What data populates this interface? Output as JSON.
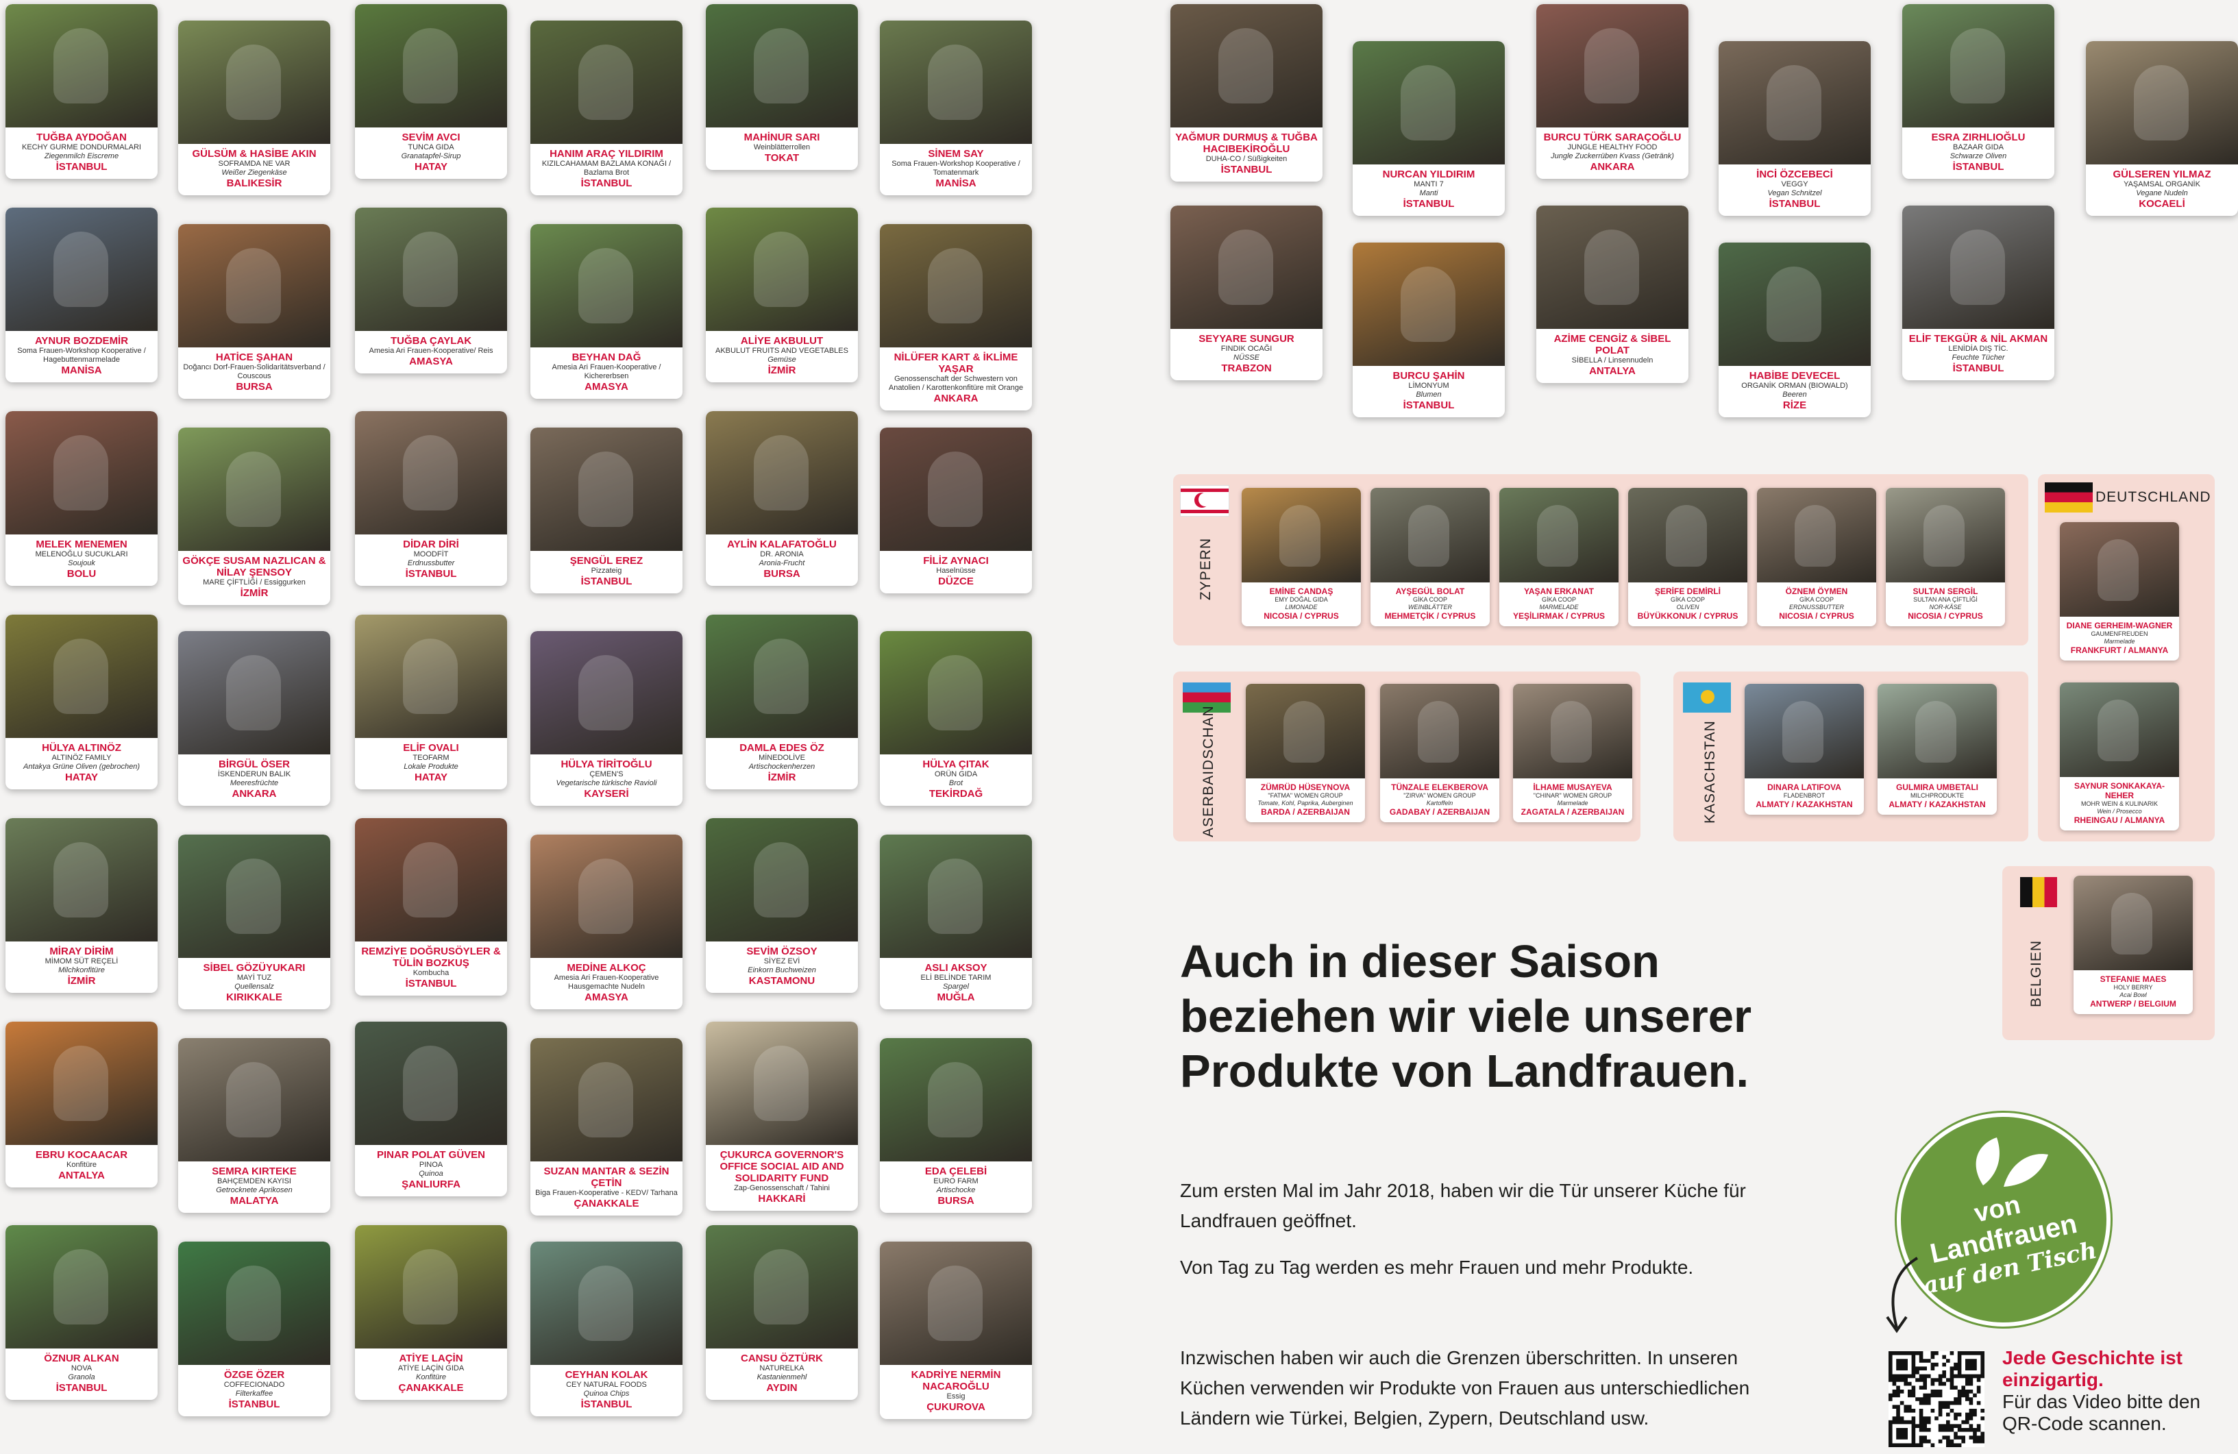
{
  "left_columns": [
    [
      {
        "name": "TUĞBA AYDOĞAN",
        "company": "KECHY GURME DONDURMALARI",
        "product": "Ziegenmilch Eiscreme",
        "city": "İSTANBUL",
        "color": "#6f8a4a"
      },
      {
        "name": "AYNUR BOZDEMİR",
        "company": "Soma Frauen-Workshop Kooperative / Hagebuttenmarmelade",
        "product": "",
        "city": "MANİSA",
        "color": "#5e6d7e"
      },
      {
        "name": "MELEK MENEMEN",
        "company": "MELENOĞLU SUCUKLARI",
        "product": "Soujouk",
        "city": "BOLU",
        "color": "#8a5a4a"
      },
      {
        "name": "HÜLYA ALTINÖZ",
        "company": "ALTINÖZ FAMILY",
        "product": "Antakya Grüne Oliven (gebrochen)",
        "city": "HATAY",
        "color": "#7e7a3a"
      },
      {
        "name": "MİRAY DİRİM",
        "company": "MİMOM SÜT REÇELİ",
        "product": "Milchkonfitüre",
        "city": "İZMİR",
        "color": "#6b7d58"
      },
      {
        "name": "EBRU KOCAACAR",
        "company": "Konfitüre",
        "product": "",
        "city": "ANTALYA",
        "color": "#c77a3a"
      },
      {
        "name": "ÖZNUR ALKAN",
        "company": "NOVA",
        "product": "Granola",
        "city": "İSTANBUL",
        "color": "#5f8a4a"
      }
    ],
    [
      {
        "name": "GÜLSÜM & HASİBE AKIN",
        "company": "SOFRAMDA NE VAR",
        "product": "Weißer Ziegenkäse",
        "city": "BALIKESİR",
        "color": "#7a8a55"
      },
      {
        "name": "HATİCE ŞAHAN",
        "company": "Doğancı Dorf-Frauen-Solidaritätsverband / Couscous",
        "product": "",
        "city": "BURSA",
        "color": "#9a6a45"
      },
      {
        "name": "GÖKÇE SUSAM NAZLICAN & NİLAY ŞENSOY",
        "company": "MARE ÇİFTLİĞİ / Essiggurken",
        "product": "",
        "city": "İZMİR",
        "color": "#7f9a5a"
      },
      {
        "name": "BİRGÜL ÖSER",
        "company": "İSKENDERUN BALIK",
        "product": "Meeresfrüchte",
        "city": "ANKARA",
        "color": "#7b7d86"
      },
      {
        "name": "SİBEL GÖZÜYUKARI",
        "company": "MAYİ TUZ",
        "product": "Quellensalz",
        "city": "KIRIKKALE",
        "color": "#55704e"
      },
      {
        "name": "SEMRA KIRTEKE",
        "company": "BAHÇEMDEN KAYISI",
        "product": "Getrocknete Aprikosen",
        "city": "MALATYA",
        "color": "#8a8070"
      },
      {
        "name": "ÖZGE ÖZER",
        "company": "COFFECIONADO",
        "product": "Filterkaffee",
        "city": "İSTANBUL",
        "color": "#3f7a45"
      }
    ],
    [
      {
        "name": "SEVİM AVCI",
        "company": "TUNCA GIDA",
        "product": "Granatapfel-Sirup",
        "city": "HATAY",
        "color": "#5a7a3e"
      },
      {
        "name": "TUĞBA ÇAYLAK",
        "company": "Amesia Ari Frauen-Kooperative/ Reis",
        "product": "",
        "city": "AMASYA",
        "color": "#6a7c55"
      },
      {
        "name": "DİDAR DİRİ",
        "company": "MOODFİT",
        "product": "Erdnussbutter",
        "city": "İSTANBUL",
        "color": "#8a7260"
      },
      {
        "name": "ELİF OVALI",
        "company": "TEOFARM",
        "product": "Lokale Produkte",
        "city": "HATAY",
        "color": "#a49a6a"
      },
      {
        "name": "REMZİYE DOĞRUSÖYLER & TÜLİN BOZKUŞ",
        "company": "Kombucha",
        "product": "",
        "city": "İSTANBUL",
        "color": "#8a5540"
      },
      {
        "name": "PINAR POLAT GÜVEN",
        "company": "PINOA",
        "product": "Quinoa",
        "city": "ŞANLIURFA",
        "color": "#4a5a48"
      },
      {
        "name": "ATİYE LAÇİN",
        "company": "ATİYE LAÇİN GIDA",
        "product": "Konfitüre",
        "city": "ÇANAKKALE",
        "color": "#8f9a40"
      }
    ],
    [
      {
        "name": "HANIM ARAÇ YILDIRIM",
        "company": "KIZILCAHAMAM BAZLAMA KONAĞI / Bazlama Brot",
        "product": "",
        "city": "İSTANBUL",
        "color": "#5a6a3e"
      },
      {
        "name": "BEYHAN DAĞ",
        "company": "Amesia Ari Frauen-Kooperative / Kichererbsen",
        "product": "",
        "city": "AMASYA",
        "color": "#6a8a4e"
      },
      {
        "name": "ŞENGÜL EREZ",
        "company": "Pizzateig",
        "product": "",
        "city": "İSTANBUL",
        "color": "#7a6a5a"
      },
      {
        "name": "HÜLYA TİRİTOĞLU",
        "company": "ÇEMEN'S",
        "product": "Vegetarische türkische Ravioli",
        "city": "KAYSERİ",
        "color": "#6a5a72"
      },
      {
        "name": "MEDİNE ALKOÇ",
        "company": "Amesia Ari Frauen-Kooperative Hausgemachte Nudeln",
        "product": "",
        "city": "AMASYA",
        "color": "#b08060"
      },
      {
        "name": "SUZAN MANTAR & SEZİN ÇETİN",
        "company": "Biga Frauen-Kooperative - KEDV/ Tarhana",
        "product": "",
        "city": "ÇANAKKALE",
        "color": "#7a7050"
      },
      {
        "name": "CEYHAN KOLAK",
        "company": "CEY NATURAL FOODS",
        "product": "Quinoa Chips",
        "city": "İSTANBUL",
        "color": "#6a8a7a"
      }
    ],
    [
      {
        "name": "MAHİNUR SARI",
        "company": "Weinblätterrollen",
        "product": "",
        "city": "TOKAT",
        "color": "#4f7040"
      },
      {
        "name": "ALİYE AKBULUT",
        "company": "AKBULUT FRUITS AND VEGETABLES",
        "product": "Gemüse",
        "city": "İZMİR",
        "color": "#6f8a45"
      },
      {
        "name": "AYLİN KALAFATOĞLU",
        "company": "DR. ARONIA",
        "product": "Aronia-Frucht",
        "city": "BURSA",
        "color": "#8a7a50"
      },
      {
        "name": "DAMLA EDES ÖZ",
        "company": "MİNEDOLİVE",
        "product": "Artischockenherzen",
        "city": "İZMİR",
        "color": "#557a45"
      },
      {
        "name": "SEVİM ÖZSOY",
        "company": "SİYEZ EVİ",
        "product": "Einkorn Buchweizen",
        "city": "KASTAMONU",
        "color": "#4e6a3e"
      },
      {
        "name": "ÇUKURCA GOVERNOR'S OFFICE SOCIAL AID AND SOLIDARITY FUND",
        "company": "Zap-Genossenschaft / Tahini",
        "product": "",
        "city": "HAKKARİ",
        "color": "#c9bca0"
      },
      {
        "name": "CANSU ÖZTÜRK",
        "company": "NATURELKA",
        "product": "Kastanienmehl",
        "city": "AYDIN",
        "color": "#5a7a4a"
      }
    ],
    [
      {
        "name": "SİNEM SAY",
        "company": "Soma Frauen-Workshop Kooperative / Tomatenmark",
        "product": "",
        "city": "MANİSA",
        "color": "#6a7a4e"
      },
      {
        "name": "NİLÜFER KART & İKLİME YAŞAR",
        "company": "Genossenschaft der Schwestern von Anatolien / Karottenkonfitüre mit Orange",
        "product": "",
        "city": "ANKARA",
        "color": "#7a6a40"
      },
      {
        "name": "FİLİZ AYNACI",
        "company": "Haselnüsse",
        "product": "",
        "city": "DÜZCE",
        "color": "#6a4a40"
      },
      {
        "name": "HÜLYA ÇITAK",
        "company": "ORÜN GIDA",
        "product": "Brot",
        "city": "TEKİRDAĞ",
        "color": "#6a8a40"
      },
      {
        "name": "ASLI AKSOY",
        "company": "ELİ BELİNDE TARIM",
        "product": "Spargel",
        "city": "MUĞLA",
        "color": "#5e7a50"
      },
      {
        "name": "EDA ÇELEBİ",
        "company": "EURO FARM",
        "product": "Artischocke",
        "city": "BURSA",
        "color": "#587a48"
      },
      {
        "name": "KADRİYE NERMİN NACAROĞLU",
        "company": "Essig",
        "product": "",
        "city": "ÇUKUROVA",
        "color": "#8a7a6a"
      }
    ]
  ],
  "right_top": [
    {
      "name": "YAĞMUR DURMUŞ & TUĞBA HACIBEKİROĞLU",
      "company": "DUHA-CO / Süßigkeiten",
      "product": "",
      "city": "İSTANBUL",
      "color": "#6a5a48"
    },
    {
      "name": "SEYYARE SUNGUR",
      "company": "FINDIK OCAĞI",
      "product": "NÜSSE",
      "city": "TRABZON",
      "color": "#7a6050"
    },
    {
      "name": "NURCAN YILDIRIM",
      "company": "MANTI 7",
      "product": "Manti",
      "city": "İSTANBUL",
      "color": "#5a7a48"
    },
    {
      "name": "BURCU ŞAHİN",
      "company": "LİMONYUM",
      "product": "Blumen",
      "city": "İSTANBUL",
      "color": "#b07a3a"
    },
    {
      "name": "BURCU TÜRK SARAÇOĞLU",
      "company": "JUNGLE HEALTHY FOOD",
      "product": "Jungle Zuckerrüben Kvass (Getränk)",
      "city": "ANKARA",
      "color": "#8a5a50"
    },
    {
      "name": "AZİME CENGİZ & SİBEL POLAT",
      "company": "SİBELLA / Linsennudeln",
      "product": "",
      "city": "ANTALYA",
      "color": "#6a6050"
    },
    {
      "name": "İNCİ ÖZCEBECİ",
      "company": "VEGGY",
      "product": "Vegan Schnitzel",
      "city": "İSTANBUL",
      "color": "#7a6a5a"
    },
    {
      "name": "HABİBE DEVECEL",
      "company": "ORGANİK ORMAN (BIOWALD)",
      "product": "Beeren",
      "city": "RİZE",
      "color": "#4e6a48"
    },
    {
      "name": "ESRA ZIRHLIOĞLU",
      "company": "BAZAAR GIDA",
      "product": "Schwarze Oliven",
      "city": "İSTANBUL",
      "color": "#6a8a5a"
    },
    {
      "name": "ELİF TEKGÜR & NİL AKMAN",
      "company": "LENİDİA DIŞ TİC.",
      "product": "Feuchte Tücher",
      "city": "İSTANBUL",
      "color": "#7a7a7a"
    },
    {
      "name": "GÜLSEREN YILMAZ",
      "company": "YAŞAMSAL ORGANİK",
      "product": "Vegane Nudeln",
      "city": "KOCAELİ",
      "color": "#9a8a70"
    }
  ],
  "cyprus": {
    "label": "ZYPERN",
    "people": [
      {
        "name": "EMİNE CANDAŞ",
        "company": "EMY DOĞAL GIDA",
        "product": "LIMONADE",
        "city": "NICOSIA / CYPRUS",
        "color": "#b88a4a"
      },
      {
        "name": "AYŞEGÜL BOLAT",
        "company": "GİKA COOP",
        "product": "WEINBLÄTTER",
        "city": "MEHMETÇİK / CYPRUS",
        "color": "#7a7a6a"
      },
      {
        "name": "YAŞAN ERKANAT",
        "company": "GİKA COOP",
        "product": "MARMELADE",
        "city": "YEŞİLIRMAK / CYPRUS",
        "color": "#6a7a5a"
      },
      {
        "name": "ŞERİFE DEMİRLİ",
        "company": "GİKA COOP",
        "product": "OLIVEN",
        "city": "BÜYÜKKONUK / CYPRUS",
        "color": "#6a6a5a"
      },
      {
        "name": "ÖZNEM ÖYMEN",
        "company": "GİKA COOP",
        "product": "ERDNUSSBUTTER",
        "city": "NICOSIA / CYPRUS",
        "color": "#8a7a6a"
      },
      {
        "name": "SULTAN SERGİL",
        "company": "SULTAN ANA ÇİFTLİĞİ",
        "product": "NOR-KÄSE",
        "city": "NICOSIA / CYPRUS",
        "color": "#9a9a8a"
      }
    ]
  },
  "azerbaijan": {
    "label": "ASERBAIDSCHAN",
    "people": [
      {
        "name": "ZÜMRÜD HÜSEYNOVA",
        "company": "\"FATMA\" WOMEN GROUP",
        "product": "Tomate, Kohl, Paprika, Auberginen",
        "city": "BARDA / AZERBAIJAN",
        "color": "#7a6a4a"
      },
      {
        "name": "TÜNZALE ELEKBEROVA",
        "company": "\"ZIRVA\" WOMEN GROUP",
        "product": "Kartoffeln",
        "city": "GADABAY / AZERBAIJAN",
        "color": "#8a7a6a"
      },
      {
        "name": "İLHAME MUSAYEVA",
        "company": "\"CHINAR\" WOMEN GROUP",
        "product": "Marmelade",
        "city": "ZAGATALA / AZERBAIJAN",
        "color": "#9a8a7a"
      }
    ]
  },
  "kazakhstan": {
    "label": "KASACHSTAN",
    "people": [
      {
        "name": "DINARA LATIFOVA",
        "company": "FLADENBROT",
        "product": "",
        "city": "ALMATY / KAZAKHSTAN",
        "color": "#7a8a9a"
      },
      {
        "name": "GULMIRA UMBETALI",
        "company": "MILCHPRODUKTE",
        "product": "",
        "city": "ALMATY / KAZAKHSTAN",
        "color": "#9aaa9a"
      }
    ]
  },
  "germany": {
    "label": "DEUTSCHLAND",
    "people": [
      {
        "name": "DIANE GERHEIM-WAGNER",
        "company": "GAUMENFREUDEN",
        "product": "Marmelade",
        "city": "FRANKFURT / ALMANYA",
        "color": "#8a6a5a"
      },
      {
        "name": "SAYNUR SONKAKAYA-NEHER",
        "company": "MOHR WEIN & KULINARIK",
        "product": "Wein / Prosecco",
        "city": "RHEINGAU / ALMANYA",
        "color": "#7a8a7a"
      }
    ]
  },
  "belgium": {
    "label": "BELGIEN",
    "people": [
      {
        "name": "STEFANIE MAES",
        "company": "HOLY BERRY",
        "product": "Acai Bowl",
        "city": "ANTWERP / BELGIUM",
        "color": "#9a8a7a"
      }
    ]
  },
  "headline": "Auch in dieser Saison beziehen wir viele unserer Produkte von Landfrauen.",
  "para1": "Zum ersten Mal im Jahr 2018, haben wir die Tür unserer Küche für Landfrauen geöffnet.",
  "para2": "Von Tag zu Tag werden es mehr Frauen und mehr Produkte.",
  "para3": "Inzwischen haben wir auch die Grenzen überschritten. In unseren Küchen verwenden wir Produkte von Frauen aus unterschiedlichen Ländern wie Türkei, Belgien, Zypern, Deutschland usw.",
  "badge": {
    "line1": "von",
    "line2": "Landfrauen",
    "line3": "auf den Tisch",
    "color": "#6b9a3e"
  },
  "qr": {
    "title": "Jede Geschichte ist einzigartig.",
    "text": "Für das Video bitte den QR-Code scannen."
  },
  "accent_color": "#d0103a",
  "panel_color": "#f6dbd4"
}
